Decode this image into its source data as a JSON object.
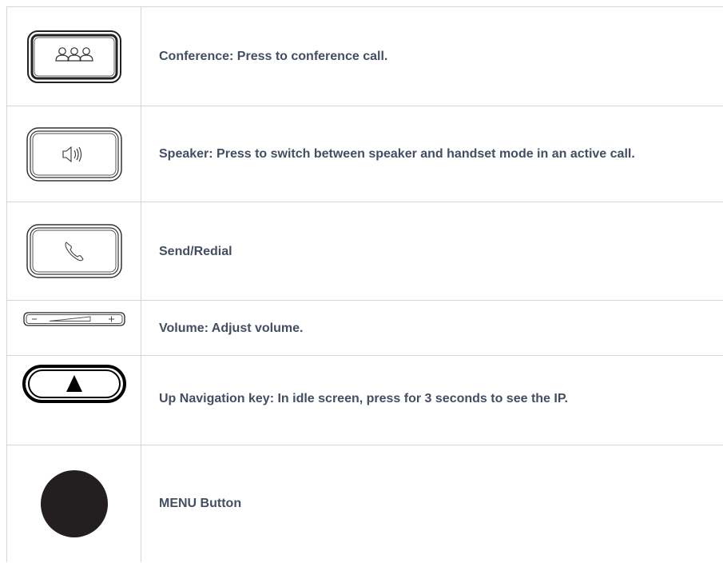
{
  "rows": [
    {
      "icon": "conference-key-icon",
      "text": "Conference: Press to conference call."
    },
    {
      "icon": "speaker-key-icon",
      "text": "Speaker: Press to switch between speaker and handset mode in an active call."
    },
    {
      "icon": "send-redial-key-icon",
      "text": "Send/Redial"
    },
    {
      "icon": "volume-key-icon",
      "text": "Volume: Adjust volume."
    },
    {
      "icon": "up-navigation-key-icon",
      "text": "Up Navigation key: In idle screen, press for 3 seconds to see the IP."
    },
    {
      "icon": "menu-button-icon",
      "text": "MENU Button"
    }
  ]
}
